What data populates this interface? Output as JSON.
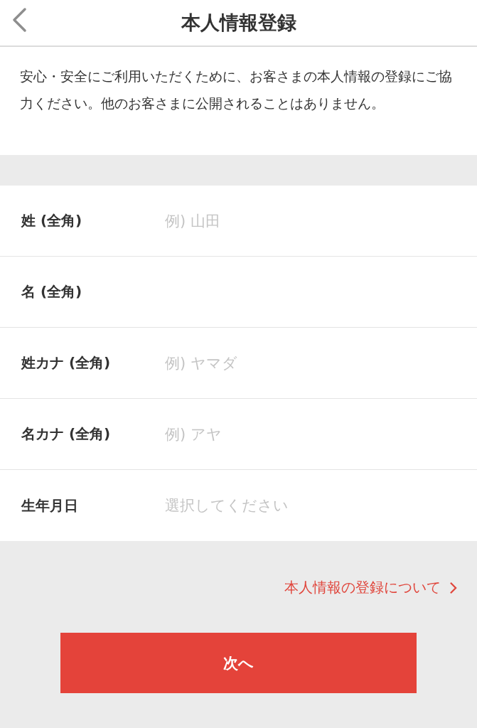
{
  "header": {
    "title": "本人情報登録"
  },
  "intro": "安心・安全にご利用いただくために、お客さまの本人情報の登録にご協力ください。他のお客さまに公開されることはありません。",
  "fields": [
    {
      "label": "姓 (全角)",
      "placeholder": "例) 山田"
    },
    {
      "label": "名 (全角)"
    },
    {
      "label": "姓カナ (全角)",
      "placeholder": "例) ヤマダ"
    },
    {
      "label": "名カナ (全角)",
      "placeholder": "例) アヤ"
    },
    {
      "label": "生年月日",
      "placeholder": "選択してください"
    }
  ],
  "info_link": "本人情報の登録について",
  "next_button": "次へ"
}
